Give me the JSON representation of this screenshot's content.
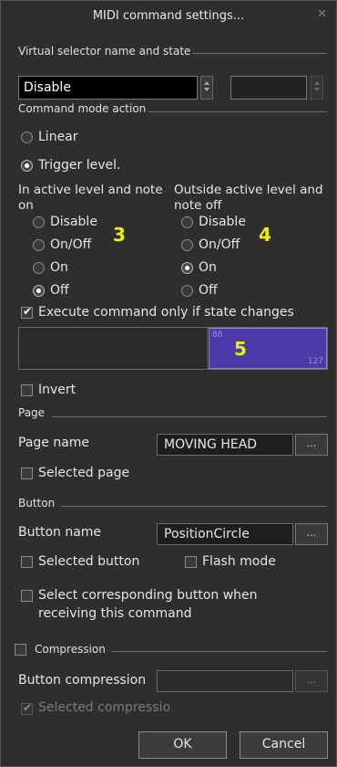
{
  "title": "MIDI command settings...",
  "virtual_selector": {
    "section_label": "Virtual selector name and state",
    "name_value": "Disable",
    "state_value": ""
  },
  "command_mode": {
    "section_label": "Command mode action",
    "linear_label": "Linear",
    "trigger_label": "Trigger level.",
    "selected_mode": "Trigger level."
  },
  "active_group": {
    "heading": "In active level and note on",
    "options": [
      "Disable",
      "On/Off",
      "On",
      "Off"
    ],
    "selected": "Off",
    "marker": "3"
  },
  "outside_group": {
    "heading": "Outside active level and note off",
    "options": [
      "Disable",
      "On/Off",
      "On",
      "Off"
    ],
    "selected": "On",
    "marker": "4"
  },
  "execute_only_changes": {
    "label": "Execute command only if state changes",
    "checked": true
  },
  "level_bar": {
    "min_label": "88",
    "max_label": "127",
    "marker": "5",
    "range_start": 88,
    "range_end": 127,
    "active_color": "#4b3aa8"
  },
  "invert": {
    "label": "Invert",
    "checked": false
  },
  "page": {
    "section_label": "Page",
    "name_label": "Page name",
    "name_value": "MOVING HEAD",
    "browse_label": "...",
    "selected_label": "Selected page",
    "selected_checked": false
  },
  "button": {
    "section_label": "Button",
    "name_label": "Button name",
    "name_value": "PositionCircle",
    "browse_label": "...",
    "selected_label": "Selected button",
    "selected_checked": false,
    "flash_label": "Flash mode",
    "flash_checked": false,
    "select_corresponding_label_line1": "Select corresponding button when",
    "select_corresponding_label_line2": "receiving this command",
    "select_corresponding_checked": false
  },
  "compression": {
    "label": "Compression",
    "checked": false,
    "button_label": "Button compression",
    "button_value": "",
    "browse_label": "...",
    "selected_label": "Selected compressio",
    "selected_checked": true
  },
  "footer": {
    "ok_label": "OK",
    "cancel_label": "Cancel"
  }
}
